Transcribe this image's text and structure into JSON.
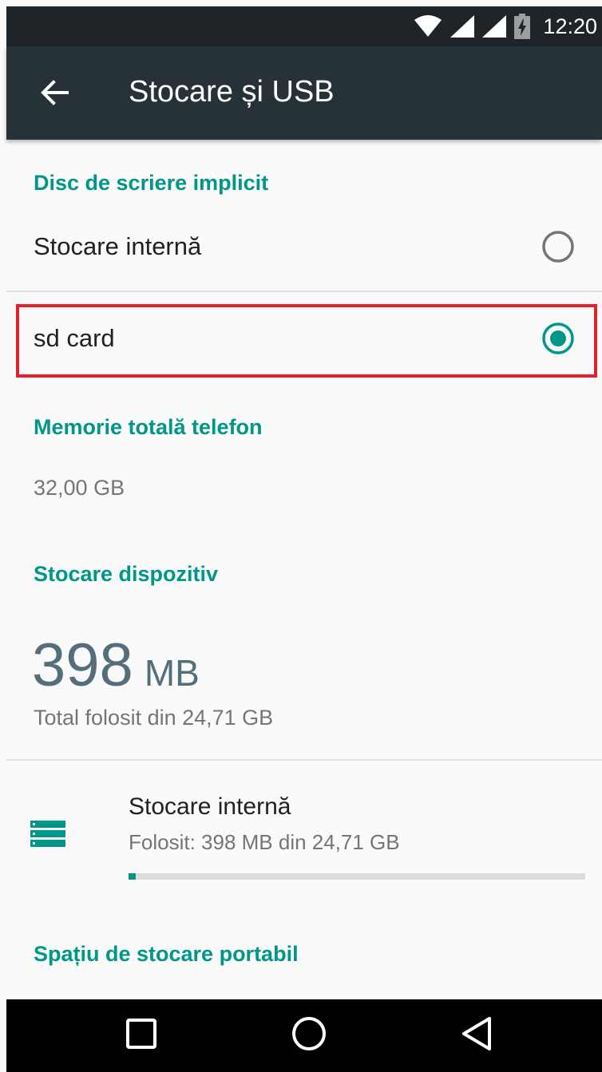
{
  "status_bar": {
    "time": "12:20",
    "icons": [
      "wifi-icon",
      "signal-icon",
      "signal-icon",
      "battery-charging-icon"
    ]
  },
  "toolbar": {
    "title": "Stocare și USB",
    "back_icon": "arrow-left-icon"
  },
  "default_write_disk": {
    "header": "Disc de scriere implicit",
    "options": [
      {
        "label": "Stocare internă",
        "selected": false
      },
      {
        "label": "sd card",
        "selected": true
      }
    ]
  },
  "total_memory": {
    "header": "Memorie totală telefon",
    "value": "32,00 GB"
  },
  "device_storage": {
    "header": "Stocare dispozitiv",
    "used_number": "398",
    "used_unit": "MB",
    "used_caption": "Total folosit din 24,71 GB",
    "items": [
      {
        "title": "Stocare internă",
        "subtitle": "Folosit: 398 MB din 24,71 GB",
        "usage_fraction": 0.016,
        "icon": "storage-icon"
      }
    ]
  },
  "portable_storage": {
    "header": "Spațiu de stocare portabil"
  },
  "nav_bar": {
    "buttons": [
      "recents-square-icon",
      "home-circle-icon",
      "back-triangle-icon"
    ]
  },
  "colors": {
    "accent": "#009688",
    "toolbar": "#263238",
    "status_bar": "#1f2428",
    "highlight": "#e5202b"
  }
}
